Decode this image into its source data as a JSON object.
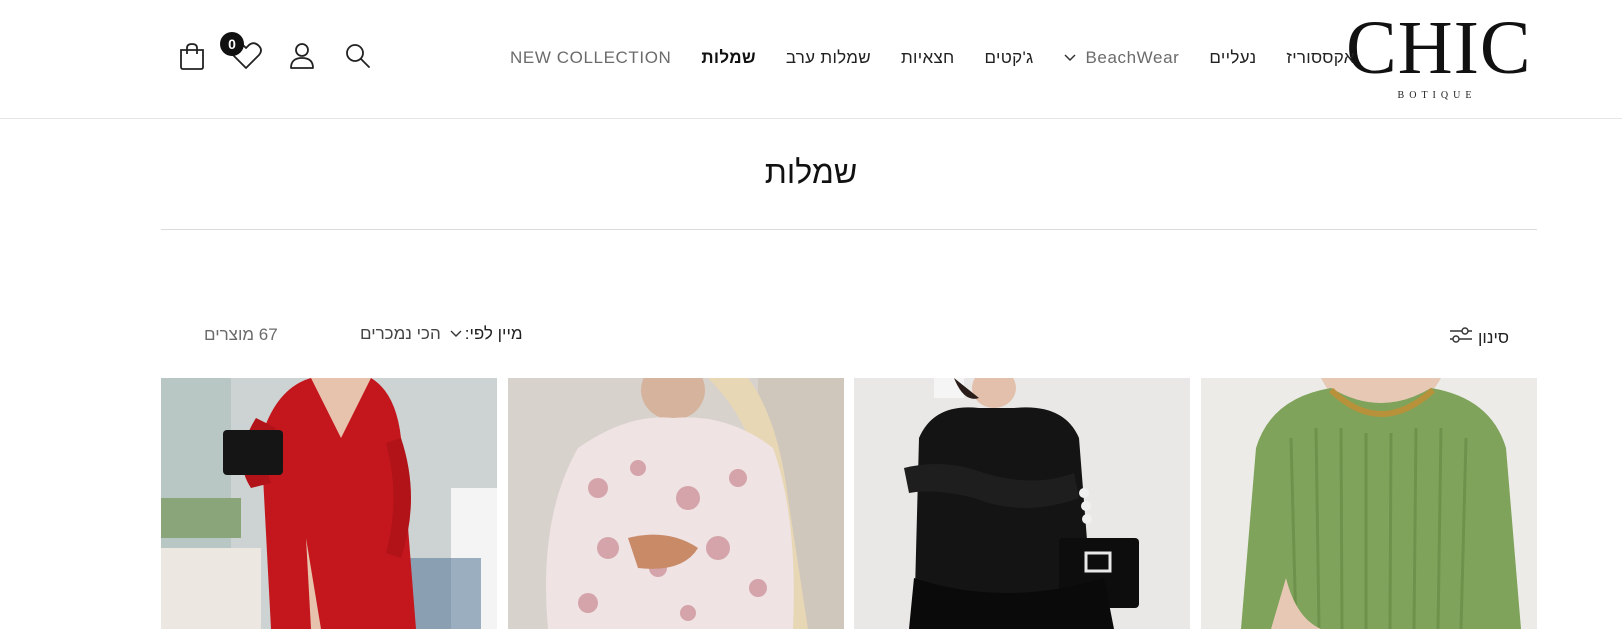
{
  "brand": {
    "logo_main": "CHIC",
    "logo_sub": "BOTIQUE"
  },
  "nav": {
    "items": [
      {
        "label": "NEW COLLECTION"
      },
      {
        "label": "שמלות"
      },
      {
        "label": "שמלות ערב"
      },
      {
        "label": "חצאיות"
      },
      {
        "label": "ג'קטים"
      },
      {
        "label": "BeachWear"
      },
      {
        "label": "נעליים"
      },
      {
        "label": "אקססוריז"
      }
    ],
    "active_index": 1
  },
  "header_icons": {
    "search": "search-icon",
    "account": "account-icon",
    "wishlist": "heart-icon",
    "cart": "shopping-bag-icon",
    "wishlist_count": "0"
  },
  "page": {
    "title": "שמלות"
  },
  "toolbar": {
    "filter_label": "סינון",
    "sort_label": "מיין לפי:",
    "sort_value": "הכי נמכרים",
    "product_count": "67 מוצרים"
  },
  "products": [
    {
      "image": "green-knit-sweater-dress",
      "color": "#7fa35a"
    },
    {
      "image": "black-puff-sleeve-dress",
      "color": "#141414"
    },
    {
      "image": "floral-print-dress",
      "color": "#e9d8d8"
    },
    {
      "image": "red-wrap-dress",
      "color": "#c4171d"
    }
  ]
}
